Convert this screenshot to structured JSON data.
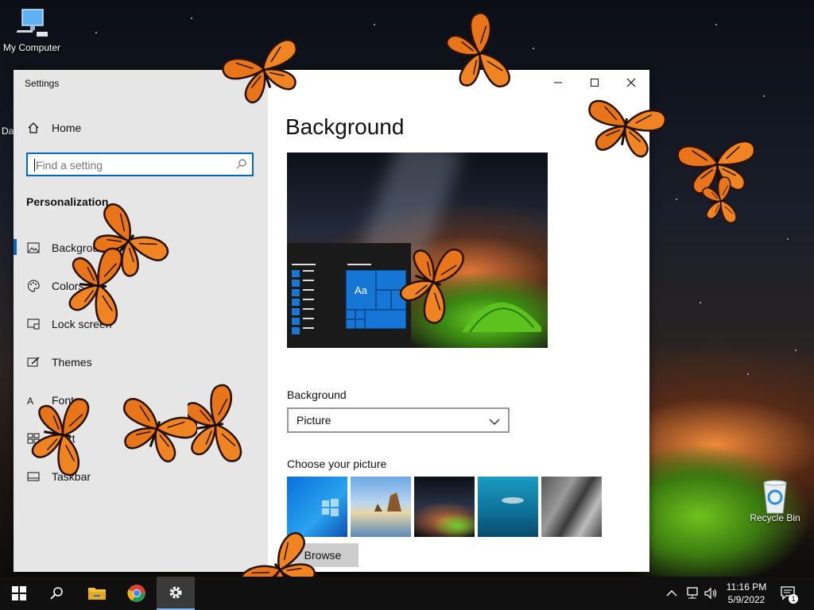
{
  "desktop": {
    "icons": [
      {
        "label": "My Computer"
      },
      {
        "label": "Recycle Bin"
      }
    ],
    "partial_label": "Da"
  },
  "window": {
    "title": "Settings",
    "controls": {
      "minimize": "—",
      "maximize": "☐",
      "close": "✕"
    }
  },
  "sidebar": {
    "home_label": "Home",
    "search": {
      "placeholder": "Find a setting"
    },
    "section_title": "Personalization",
    "items": [
      {
        "label": "Background"
      },
      {
        "label": "Colors"
      },
      {
        "label": "Lock screen"
      },
      {
        "label": "Themes"
      },
      {
        "label": "Fonts"
      },
      {
        "label": "Start"
      },
      {
        "label": "Taskbar"
      }
    ]
  },
  "main": {
    "title": "Background",
    "preview": {
      "tile_label": "Aa"
    },
    "background_label": "Background",
    "background_value": "Picture",
    "choose_label": "Choose your picture",
    "browse_label": "Browse"
  },
  "taskbar": {
    "time": "11:16 PM",
    "date": "5/9/2022",
    "notification_count": "1"
  },
  "colors": {
    "accent": "#0067c0",
    "sidebar_bg": "#e6e6e6",
    "taskbar_bg": "#101010",
    "butterfly_orange": "#e8751a"
  }
}
